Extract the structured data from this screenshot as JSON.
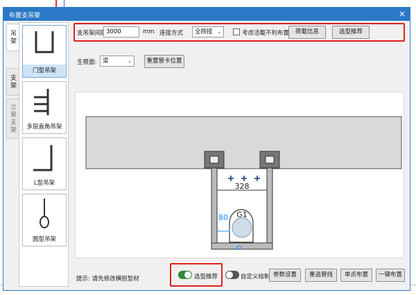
{
  "dialog": {
    "title": "布置支吊架",
    "close": "×"
  },
  "side_tabs": [
    {
      "label": "吊架",
      "active": true
    },
    {
      "label": "支架",
      "active": false
    },
    {
      "label": "立管支架",
      "active": false
    }
  ],
  "types": [
    {
      "label": "门型吊架",
      "selected": true
    },
    {
      "label": "多层直角吊架",
      "selected": false
    },
    {
      "label": "L型吊架",
      "selected": false
    },
    {
      "label": "圆型吊架",
      "selected": false
    }
  ],
  "params": {
    "spacing_label": "支吊架间距",
    "spacing_value": "3000",
    "spacing_unit": "mm",
    "connect_label": "连接方式",
    "connect_value": "全刚接",
    "consider_label": "考虑活載不利布置",
    "load_btn": "荷載信息",
    "select_btn": "选型推荐"
  },
  "root": {
    "label": "生根面:",
    "value": "梁",
    "reset_btn": "重置管卡位置"
  },
  "drawing": {
    "width_dim": "328",
    "side_dim": "80",
    "pipe_label": "G1"
  },
  "footer": {
    "hint": "提示: 请先修改横担型材",
    "toggle1_label": "选型推荐",
    "toggle1_on": true,
    "toggle2_label": "自定义绘制",
    "toggle2_on": false,
    "btn_params": "参数设置",
    "btn_reselect": "重选管线",
    "btn_single": "单点布置",
    "btn_auto": "一键布置"
  },
  "colors": {
    "accent": "#2b78c6",
    "highlight": "#e02020",
    "toggle_on": "#2f8a3a",
    "dim": "#1e90ff"
  }
}
